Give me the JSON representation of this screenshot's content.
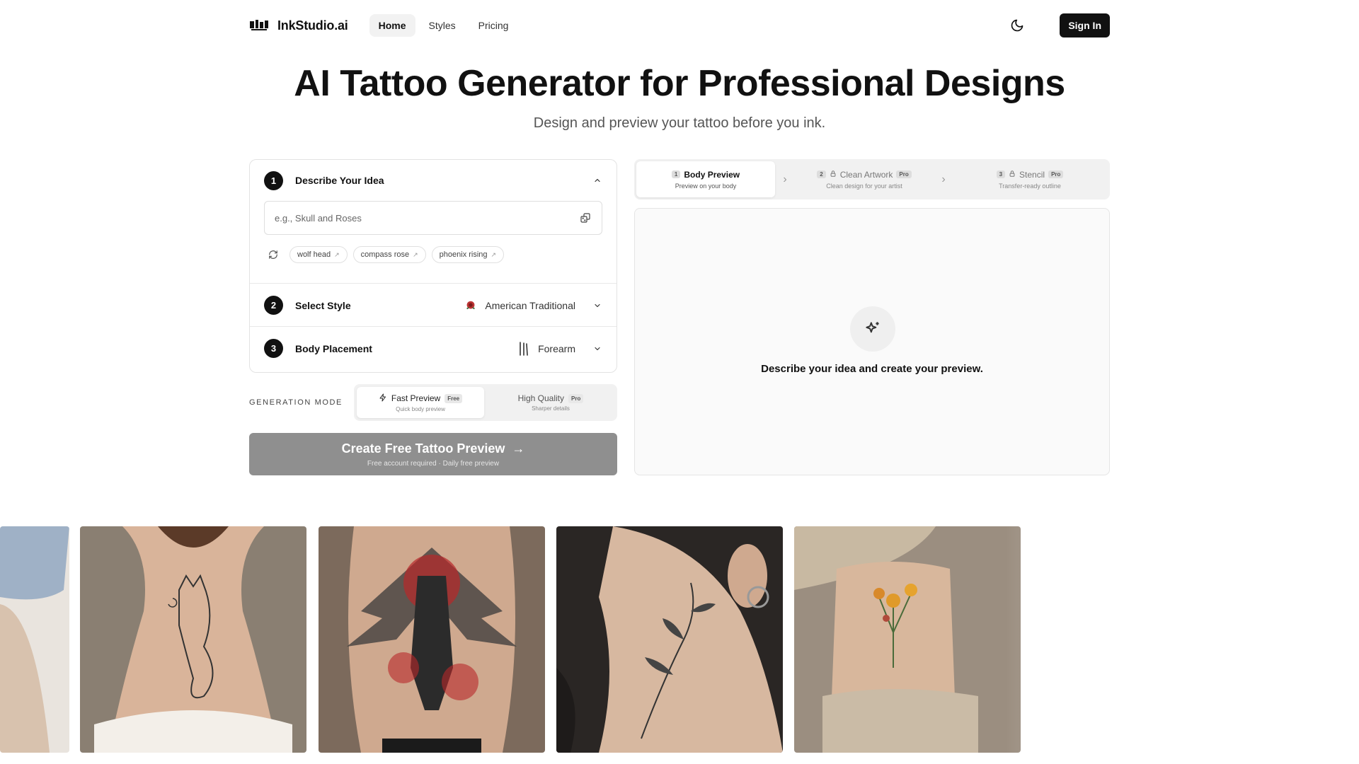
{
  "header": {
    "logo_text": "InkStudio.ai",
    "nav": [
      {
        "label": "Home",
        "active": true
      },
      {
        "label": "Styles",
        "active": false
      },
      {
        "label": "Pricing",
        "active": false
      }
    ],
    "theme_icon": "moon-icon",
    "signin_label": "Sign In"
  },
  "hero": {
    "title": "AI Tattoo Generator for Professional Designs",
    "subtitle": "Design and preview your tattoo before you ink."
  },
  "steps": {
    "idea": {
      "number": "1",
      "title": "Describe Your Idea",
      "placeholder": "e.g., Skull and Roses",
      "chips": [
        "wolf head",
        "compass rose",
        "phoenix rising"
      ],
      "chip_arrow": "↗"
    },
    "style": {
      "number": "2",
      "title": "Select Style",
      "value": "American Traditional"
    },
    "placement": {
      "number": "3",
      "title": "Body Placement",
      "value": "Forearm"
    }
  },
  "generation_mode": {
    "label": "GENERATION MODE",
    "options": [
      {
        "label": "Fast Preview",
        "tag": "Free",
        "sub": "Quick body preview",
        "active": true
      },
      {
        "label": "High Quality",
        "tag": "Pro",
        "sub": "Sharper details",
        "active": false
      }
    ]
  },
  "cta": {
    "label": "Create Free Tattoo Preview",
    "arrow": "→",
    "sub": "Free account required · Daily free preview"
  },
  "output_tabs": [
    {
      "num": "1",
      "label": "Body Preview",
      "sub": "Preview on your body",
      "active": true,
      "locked": false,
      "badge": ""
    },
    {
      "num": "2",
      "label": "Clean Artwork",
      "sub": "Clean design for your artist",
      "active": false,
      "locked": true,
      "badge": "Pro"
    },
    {
      "num": "3",
      "label": "Stencil",
      "sub": "Transfer-ready outline",
      "active": false,
      "locked": true,
      "badge": "Pro"
    }
  ],
  "tab_separator": "›",
  "preview": {
    "icon": "sparkles-icon",
    "message": "Describe your idea and create your preview."
  },
  "gallery": [
    {
      "name": "gallery-image-arm",
      "desc": "arm with denim"
    },
    {
      "name": "gallery-image-fox-back",
      "desc": "fox tattoo on back"
    },
    {
      "name": "gallery-image-warrior-back",
      "desc": "angel warrior back piece"
    },
    {
      "name": "gallery-image-neck-floral",
      "desc": "floral neck tattoo"
    },
    {
      "name": "gallery-image-ankle-flowers",
      "desc": "wildflower ankle tattoo"
    }
  ],
  "colors": {
    "primary": "#111111",
    "cta_disabled": "#8f8f8f",
    "panel_border": "#e3e3e3",
    "muted_bg": "#f1f1f1"
  }
}
